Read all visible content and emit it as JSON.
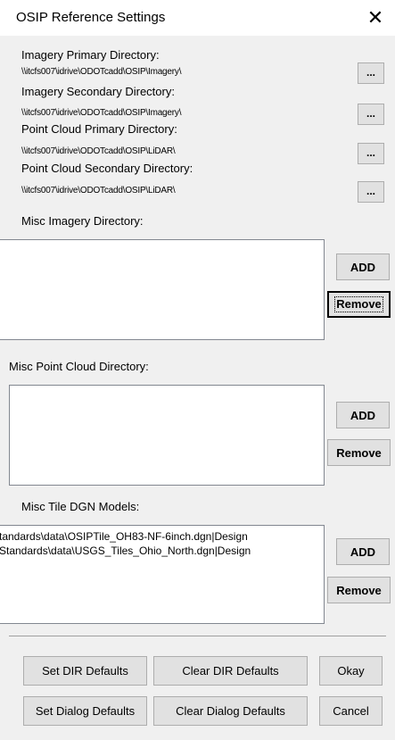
{
  "window": {
    "title": "OSIP Reference Settings",
    "close_glyph": "✕"
  },
  "directories": [
    {
      "label": "Imagery Primary Directory:",
      "path": "\\\\itcfs007\\idrive\\ODOTcadd\\OSIP\\Imagery\\",
      "browse_label": "..."
    },
    {
      "label": "Imagery Secondary Directory:",
      "path": "\\\\itcfs007\\idrive\\ODOTcadd\\OSIP\\Imagery\\",
      "browse_label": "..."
    },
    {
      "label": "Point Cloud Primary Directory:",
      "path": "\\\\itcfs007\\idrive\\ODOTcadd\\OSIP\\LiDAR\\",
      "browse_label": "..."
    },
    {
      "label": "Point Cloud Secondary Directory:",
      "path": "\\\\itcfs007\\idrive\\ODOTcadd\\OSIP\\LiDAR\\",
      "browse_label": "..."
    }
  ],
  "misc_imagery": {
    "label": "Misc Imagery Directory:",
    "items": [],
    "add_label": "ADD",
    "remove_label": "Remove"
  },
  "misc_point_cloud": {
    "label": "Misc Point Cloud Directory:",
    "items": [],
    "add_label": "ADD",
    "remove_label": "Remove"
  },
  "misc_tile": {
    "label": "Misc Tile DGN Models:",
    "items": [
      "tandards\\data\\OSIPTile_OH83-NF-6inch.dgn|Design",
      "Standards\\data\\USGS_Tiles_Ohio_North.dgn|Design"
    ],
    "add_label": "ADD",
    "remove_label": "Remove"
  },
  "footer": {
    "set_dir_defaults": "Set DIR Defaults",
    "clear_dir_defaults": "Clear DIR Defaults",
    "okay": "Okay",
    "set_dialog_defaults": "Set Dialog Defaults",
    "clear_dialog_defaults": "Clear Dialog Defaults",
    "cancel": "Cancel"
  }
}
